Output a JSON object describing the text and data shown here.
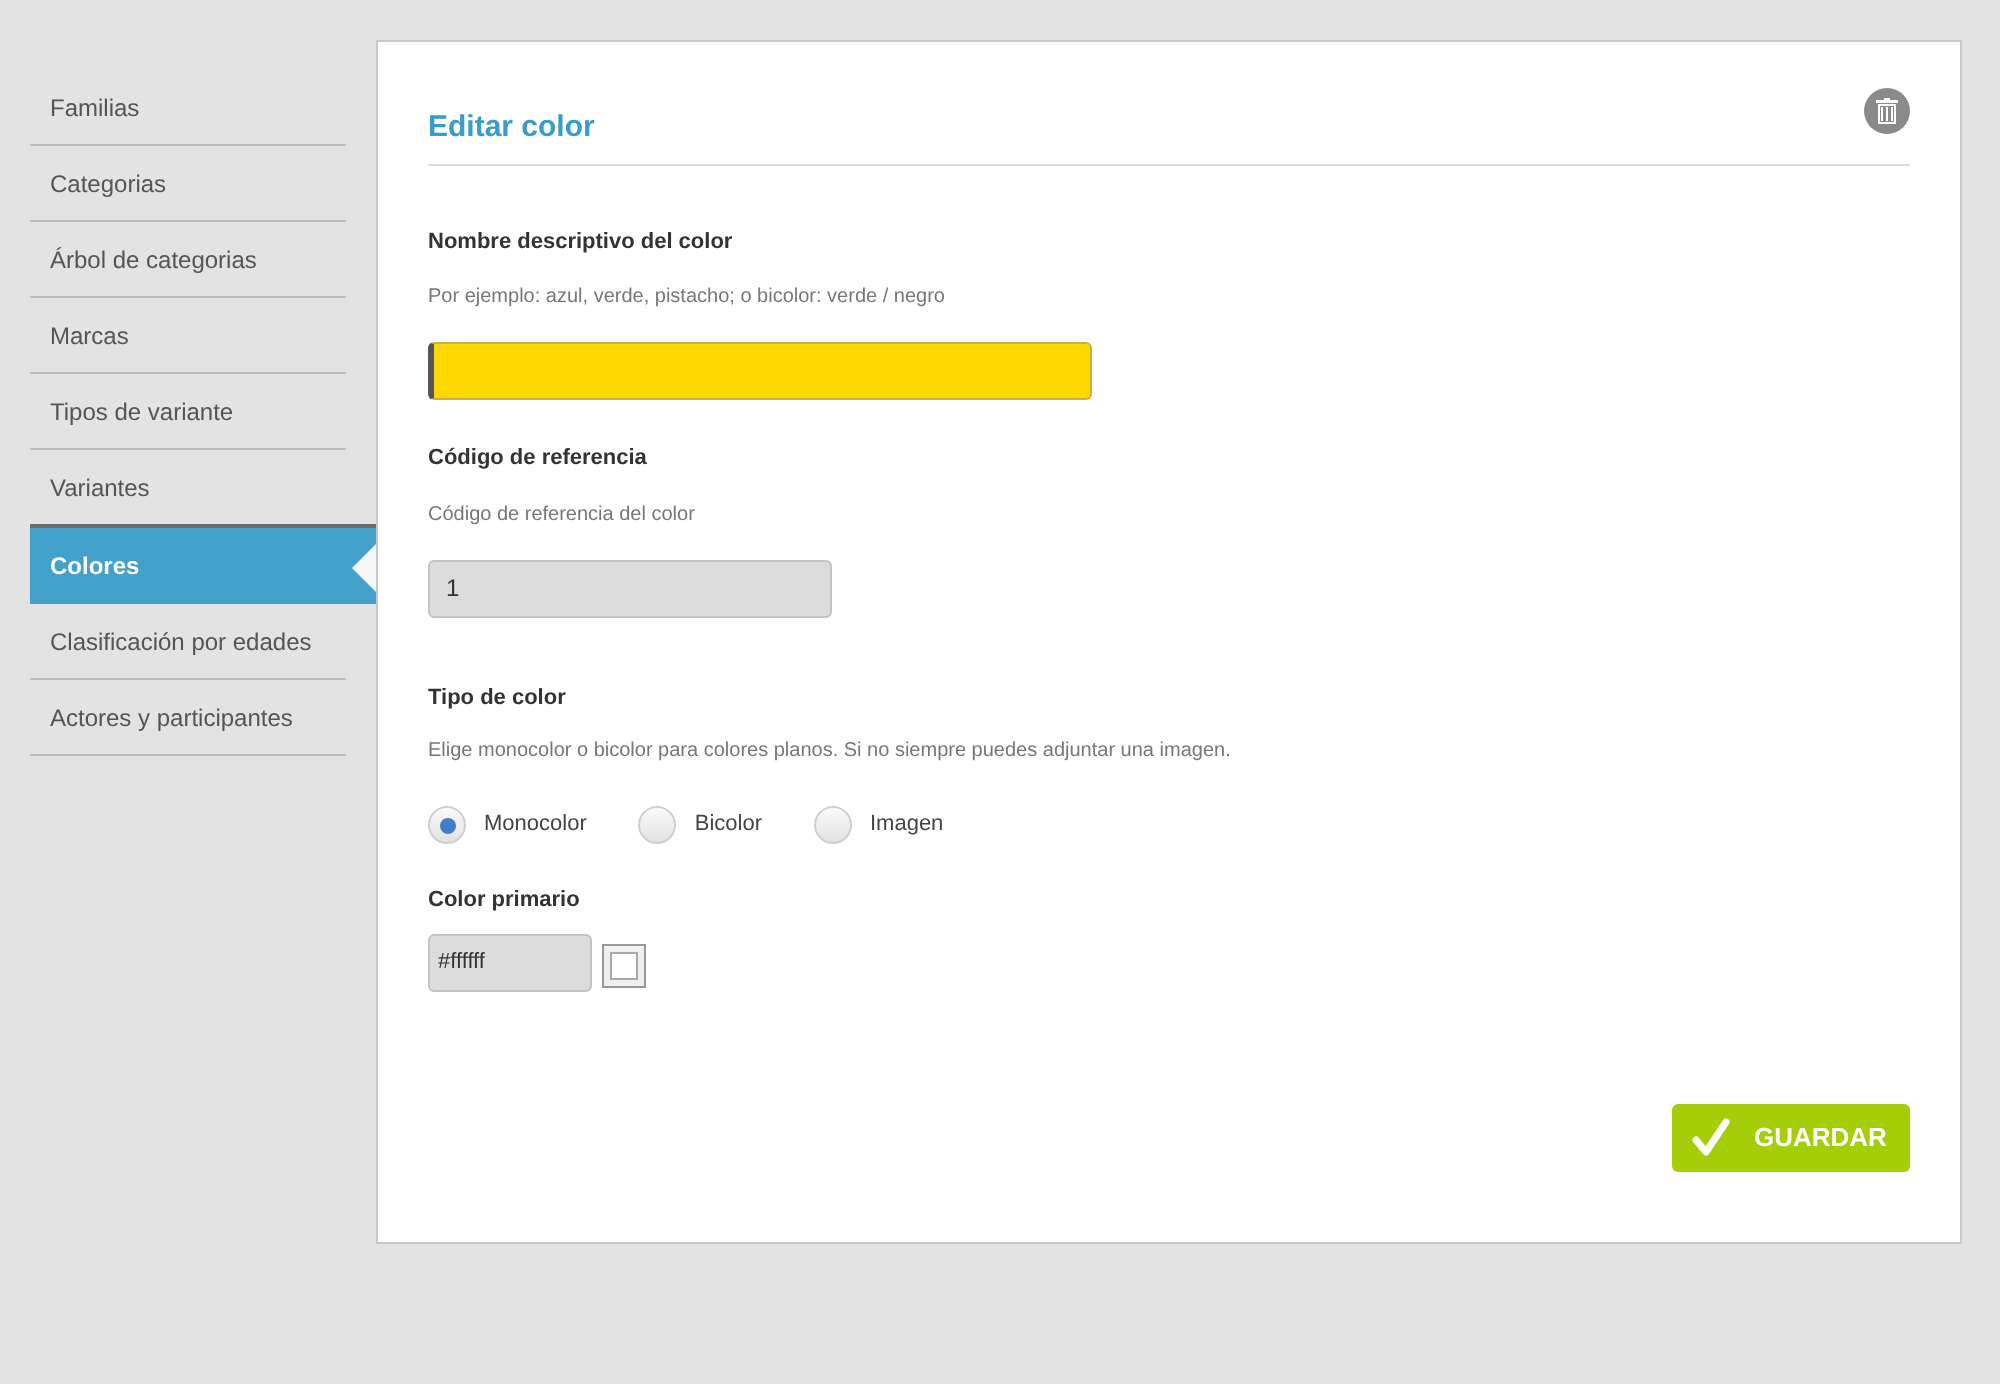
{
  "sidebar": {
    "items": [
      {
        "label": "Familias",
        "selected": false
      },
      {
        "label": "Categorias",
        "selected": false
      },
      {
        "label": "Árbol de categorias",
        "selected": false
      },
      {
        "label": "Marcas",
        "selected": false
      },
      {
        "label": "Tipos de variante",
        "selected": false
      },
      {
        "label": "Variantes",
        "selected": false
      },
      {
        "label": "Colores",
        "selected": true
      },
      {
        "label": "Clasificación por edades",
        "selected": false
      },
      {
        "label": "Actores y participantes",
        "selected": false
      }
    ]
  },
  "form": {
    "title": "Editar color",
    "name_field": {
      "label": "Nombre descriptivo del color",
      "help": "Por ejemplo: azul, verde, pistacho; o bicolor: verde / negro",
      "focused": true
    },
    "reference_field": {
      "label": "Código de referencia",
      "help": "Código de referencia del color",
      "value": "1",
      "focused": false
    },
    "color_type": {
      "label": "Tipo de color",
      "help": "Elige monocolor o bicolor para colores planos. Si no siempre puedes adjuntar una imagen.",
      "options": [
        {
          "label": "Monocolor",
          "selected": true
        },
        {
          "label": "Bicolor",
          "selected": false
        },
        {
          "label": "Imagen",
          "selected": false
        }
      ]
    },
    "primary_color": {
      "label": "Color primario",
      "value": "#ffffff"
    },
    "save_button": "GUARDAR"
  }
}
